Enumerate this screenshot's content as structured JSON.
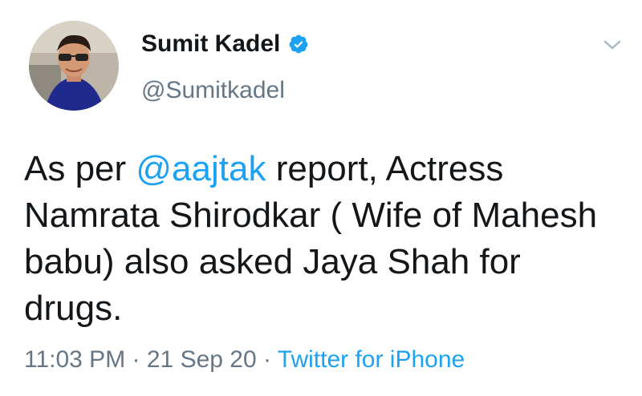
{
  "tweet": {
    "author": {
      "display_name": "Sumit Kadel",
      "handle": "@Sumitkadel",
      "verified": true
    },
    "text_before": "As per ",
    "mention": "@aajtak",
    "text_after": " report, Actress Namrata Shirodkar ( Wife of Mahesh babu) also asked Jaya Shah for drugs.",
    "time": "11:03 PM",
    "separator_1": " · ",
    "date": "21 Sep 20",
    "separator_2": " · ",
    "source": "Twitter for iPhone"
  },
  "colors": {
    "link": "#1da1f2",
    "secondary_text": "#657786",
    "primary_text": "#14171a"
  },
  "icons": {
    "verified": "verified-badge-icon",
    "menu": "chevron-down-icon"
  }
}
